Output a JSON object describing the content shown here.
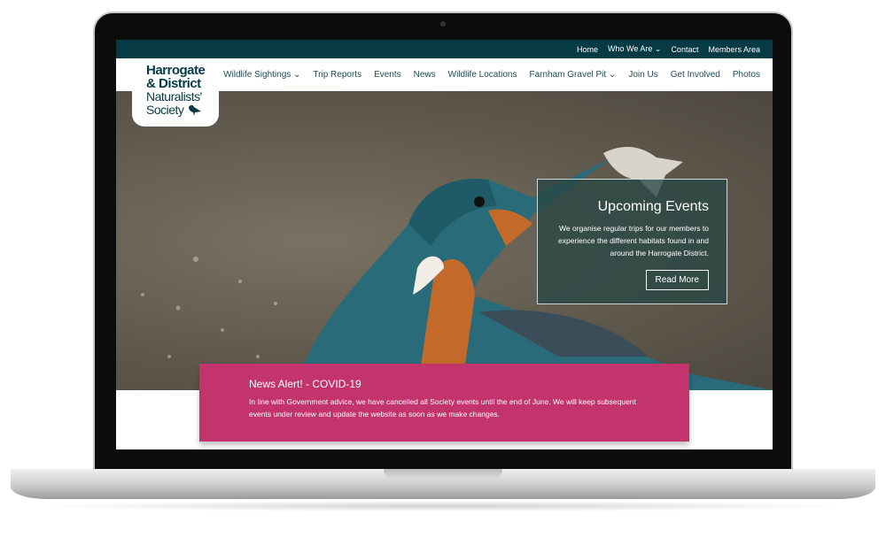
{
  "logo": {
    "line1": "Harrogate",
    "line2": "& District",
    "line3": "Naturalists'",
    "line4": "Society"
  },
  "topnav": [
    {
      "label": "Home"
    },
    {
      "label": "Who We Are ⌄"
    },
    {
      "label": "Contact"
    },
    {
      "label": "Members Area"
    }
  ],
  "mainnav": [
    {
      "label": "Wildlife Sightings ⌄"
    },
    {
      "label": "Trip Reports"
    },
    {
      "label": "Events"
    },
    {
      "label": "News"
    },
    {
      "label": "Wildlife Locations"
    },
    {
      "label": "Farnham Gravel Pit ⌄"
    },
    {
      "label": "Join Us"
    },
    {
      "label": "Get Involved"
    },
    {
      "label": "Photos"
    }
  ],
  "events": {
    "title": "Upcoming Events",
    "text": "We organise regular trips for our members to experience the different habitats found in and around the Harrogate District.",
    "button": "Read More"
  },
  "alert": {
    "title": "News Alert! - COVID-19",
    "text": "In line with Government advice, we have cancelled all Society events until the end of June. We will keep subsequent events under review and update the website as soon as we make changes."
  },
  "colors": {
    "topbar": "#063a45",
    "alert": "#c2346b",
    "nav_text": "#1f4a55"
  },
  "hero_image": "kingfisher-with-fish"
}
